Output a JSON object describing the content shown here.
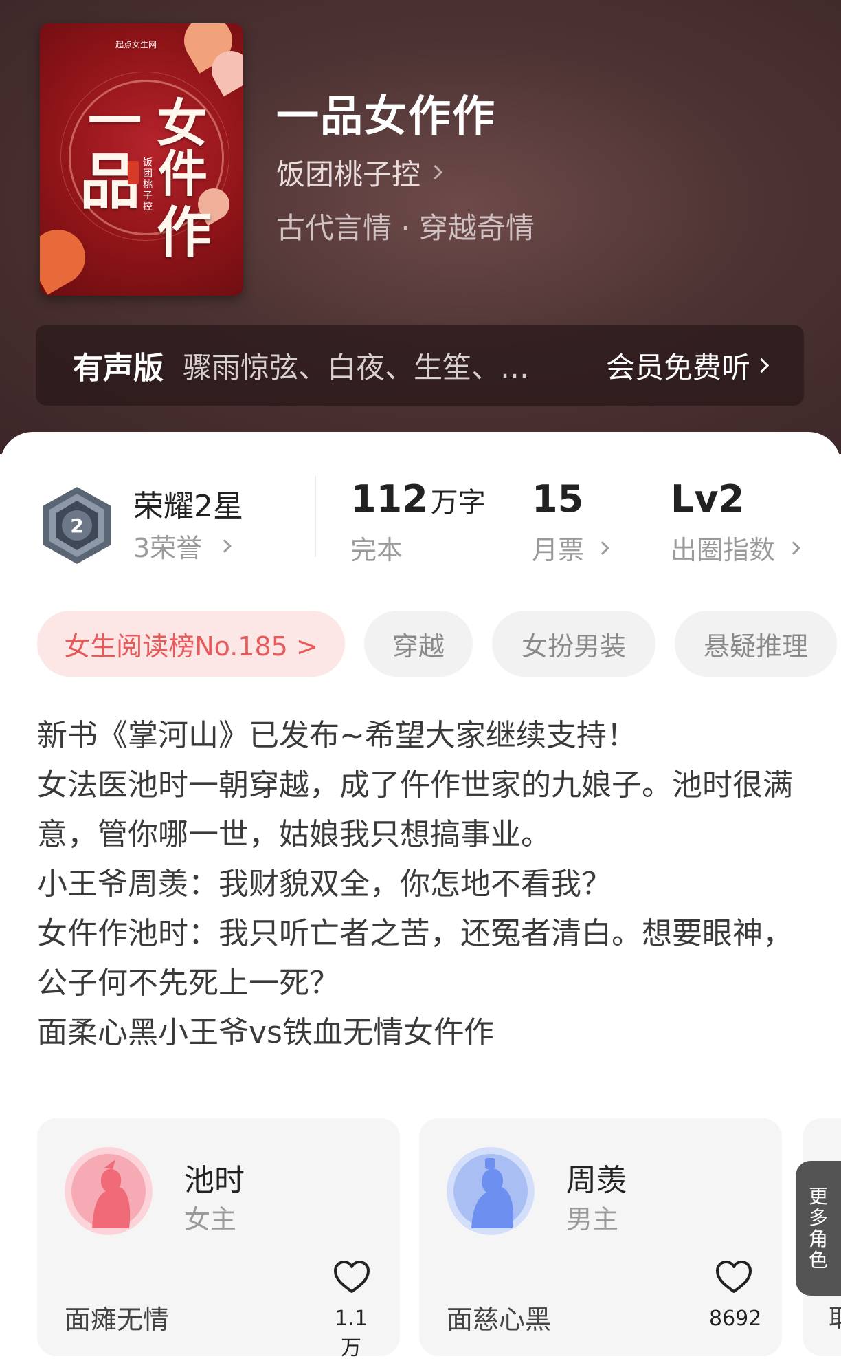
{
  "book": {
    "title": "一品女作作",
    "author": "饭团桃子控",
    "genre": "古代言情 · 穿越奇情",
    "cover": {
      "publisher": "起点女生网",
      "title_chars": [
        "一",
        "品",
        "女",
        "件",
        "作"
      ],
      "author_vertical": "饭团桃子控"
    }
  },
  "audio": {
    "label": "有声版",
    "cast": "骤雨惊弦、白夜、生笙、…",
    "action": "会员免费听"
  },
  "stats": {
    "honor_title": "荣耀2星",
    "honor_sub": "3荣誉",
    "badge_level": "2",
    "words_num": "112",
    "words_unit": "万字",
    "words_label": "完本",
    "monthly_num": "15",
    "monthly_label": "月票",
    "level_num": "Lv2",
    "level_label": "出圈指数"
  },
  "tags": [
    "女生阅读榜No.185 >",
    "穿越",
    "女扮男装",
    "悬疑推理"
  ],
  "description": [
    "新书《掌河山》已发布~希望大家继续支持！",
    "女法医池时一朝穿越，成了仵作世家的九娘子。池时很满意，管你哪一世，姑娘我只想搞事业。",
    "小王爷周羡：我财貌双全，你怎地不看我？",
    "女仵作池时：我只听亡者之苦，还冤者清白。想要眼神，公子何不先死上一死？",
    "面柔心黑小王爷vs铁血无情女仵作"
  ],
  "characters": [
    {
      "name": "池时",
      "role": "女主",
      "trait": "面瘫无情",
      "likes": "1.1万",
      "color": "#f06a78"
    },
    {
      "name": "周羡",
      "role": "男主",
      "trait": "面慈心黑",
      "likes": "8692",
      "color": "#6d8ff0"
    }
  ],
  "more_roles": "更多角色",
  "third_card_text": "耶"
}
